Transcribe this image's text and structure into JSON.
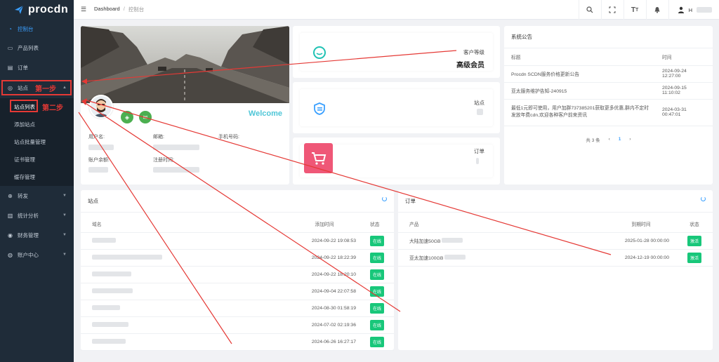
{
  "brand": {
    "name": "procdn"
  },
  "colors": {
    "accent": "#3aa0ff",
    "sidebar": "#1f2c39",
    "success": "#18c77a",
    "annotation": "#e53935",
    "order_icon": "#ef5777"
  },
  "sidebar": {
    "items": [
      {
        "icon": "dashboard-icon",
        "label": "控制台",
        "active": true
      },
      {
        "icon": "product-icon",
        "label": "产品列表"
      },
      {
        "icon": "order-icon",
        "label": "订单"
      },
      {
        "icon": "site-icon",
        "label": "站点",
        "expanded": true
      },
      {
        "icon": "forward-icon",
        "label": "转发"
      },
      {
        "icon": "stats-icon",
        "label": "统计分析"
      },
      {
        "icon": "finance-icon",
        "label": "财务管理"
      },
      {
        "icon": "account-icon",
        "label": "账户中心"
      }
    ],
    "sub_items": [
      {
        "label": "站点列表",
        "active": true
      },
      {
        "label": "添加站点"
      },
      {
        "label": "站点批量管理"
      },
      {
        "label": "证书管理"
      },
      {
        "label": "缓存管理"
      }
    ]
  },
  "header": {
    "breadcrumb": [
      "Dashboard",
      "控制台"
    ],
    "user_initial": "H",
    "icons": [
      "search-icon",
      "fullscreen-icon",
      "font-size-icon",
      "bell-icon",
      "user-icon"
    ]
  },
  "profile": {
    "welcome": "Welcome",
    "labels": {
      "username": "用户名:",
      "email": "邮箱:",
      "phone": "手机号码:",
      "balance": "账户余额:",
      "register_time": "注册时间:"
    }
  },
  "stats": {
    "level_label": "客户等级",
    "level_value": "高级会员",
    "sites_label": "站点",
    "orders_label": "订单"
  },
  "notice": {
    "title": "系统公告",
    "columns": [
      "标题",
      "时间"
    ],
    "rows": [
      {
        "title": "Procdn SCDN服务价格更新公告",
        "time": "2024-09-24 12:27:00"
      },
      {
        "title": "亚太服务维护告知-240915",
        "time": "2024-09-15 11:10:02"
      },
      {
        "title": "最低1元即可使用，用户加群737385201获取更多优惠,群内不定时发放年费cdn,欢迎各种客户前来资讯",
        "time": "2024-03-31 00:47:01"
      }
    ],
    "pager": {
      "total": "共 3 条",
      "prev": "‹",
      "page": "1",
      "next": "›"
    }
  },
  "sites": {
    "title": "站点",
    "columns": [
      "域名",
      "添加时间",
      "状态"
    ],
    "rows": [
      {
        "time": "2024-09-22 19:08:53",
        "status": "在线"
      },
      {
        "time": "2024-09-22 18:22:39",
        "status": "在线"
      },
      {
        "time": "2024-09-22 18:20:10",
        "status": "在线"
      },
      {
        "time": "2024-09-04 22:07:58",
        "status": "在线"
      },
      {
        "time": "2024-08-30 01:58:19",
        "status": "在线"
      },
      {
        "time": "2024-07-02 02:19:36",
        "status": "在线"
      },
      {
        "time": "2024-06-26 16:27:17",
        "status": "在线"
      }
    ]
  },
  "orders": {
    "title": "订单",
    "columns": [
      "产品",
      "到期时间",
      "状态"
    ],
    "rows": [
      {
        "product": "大陆加速50GB",
        "expire": "2025-01-28 00:00:00",
        "status": "激活"
      },
      {
        "product": "亚太加速100GB",
        "expire": "2024-12-19 00:00:00",
        "status": "激活"
      }
    ]
  },
  "annotations": {
    "step1": "第一步",
    "step2": "第二步"
  }
}
